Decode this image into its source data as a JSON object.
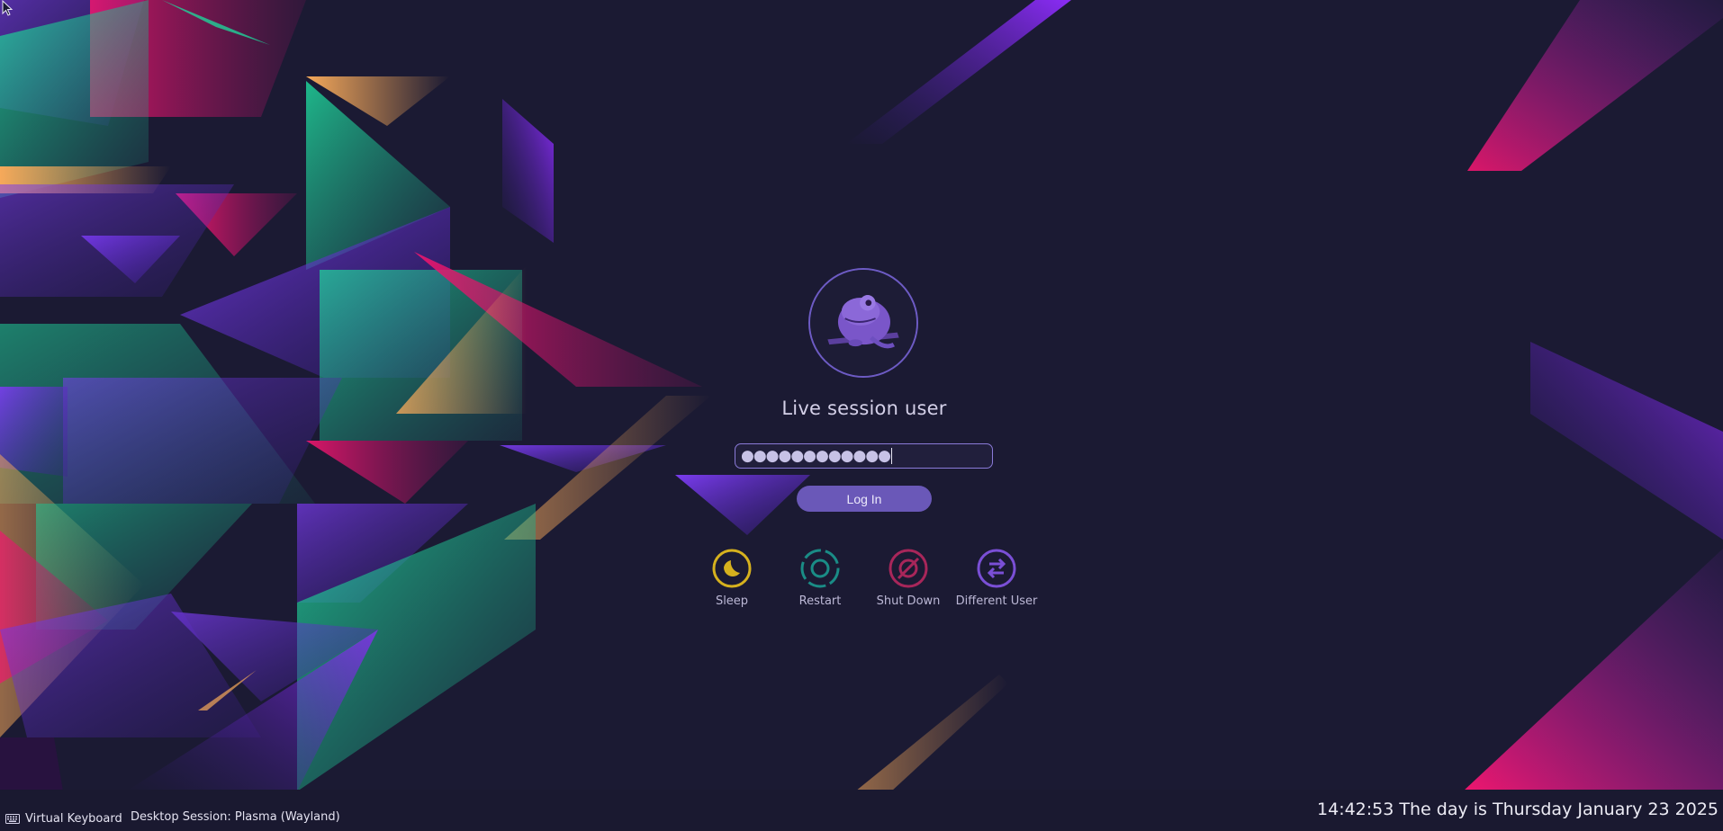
{
  "user": {
    "name": "Live session user"
  },
  "password": {
    "masked": "●●●●●●●●●●●●"
  },
  "login_button": "Log In",
  "actions": [
    {
      "label": "Sleep",
      "icon": "sleep-icon",
      "color": "#d6b11e"
    },
    {
      "label": "Restart",
      "icon": "restart-icon",
      "color": "#1a8c86"
    },
    {
      "label": "Shut Down",
      "icon": "shutdown-icon",
      "color": "#a8265a"
    },
    {
      "label": "Different User",
      "icon": "switch-user-icon",
      "color": "#7a4fd6"
    }
  ],
  "bottom_bar": {
    "virtual_keyboard": "Virtual Keyboard",
    "session": "Desktop Session: Plasma (Wayland)",
    "clock": "14:42:53 The day is Thursday January 23 2025"
  },
  "colors": {
    "background": "#1b1a33",
    "accent": "#6a58b8"
  }
}
